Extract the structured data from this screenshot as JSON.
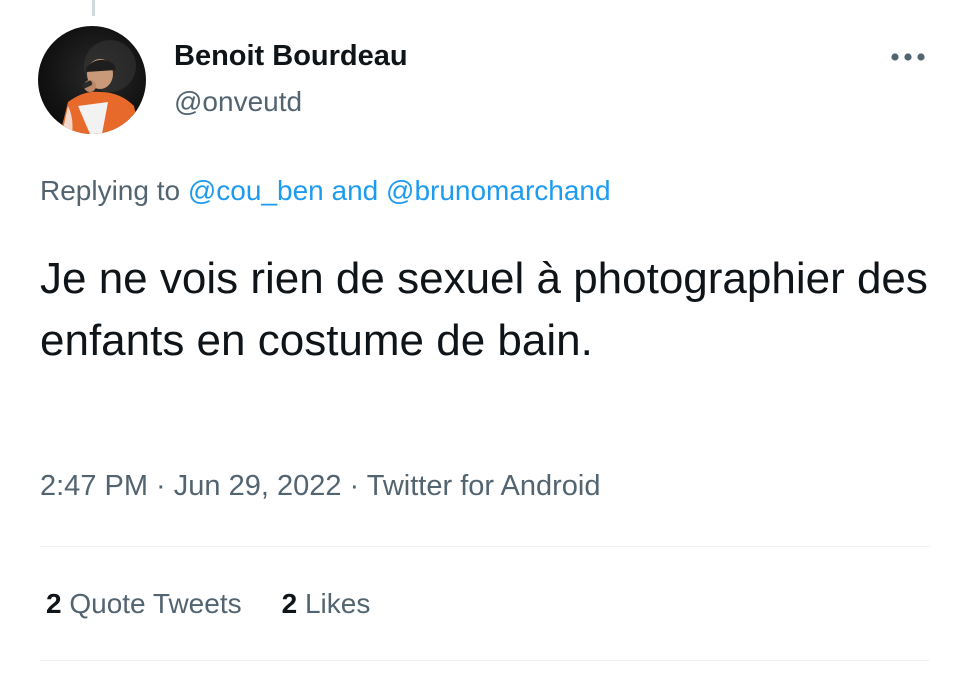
{
  "author": {
    "display_name": "Benoit Bourdeau",
    "handle": "@onveutd"
  },
  "reply": {
    "prefix": "Replying to ",
    "mention_1": "@cou_ben",
    "connector": " and ",
    "mention_2": "@brunomarchand"
  },
  "tweet": {
    "text": "Je ne vois rien de sexuel à photographier des enfants en costume de bain."
  },
  "meta": {
    "time": "2:47 PM",
    "separator_1": " · ",
    "date": "Jun 29, 2022",
    "separator_2": " · ",
    "source": "Twitter for Android"
  },
  "stats": {
    "quote_tweets_count": "2",
    "quote_tweets_label": " Quote Tweets",
    "likes_count": "2",
    "likes_label": " Likes"
  },
  "icons": {
    "more": "more-horizontal-icon"
  },
  "colors": {
    "text_primary": "#0f1419",
    "text_secondary": "#536471",
    "link": "#1d9bf0",
    "divider": "#eff3f4"
  }
}
